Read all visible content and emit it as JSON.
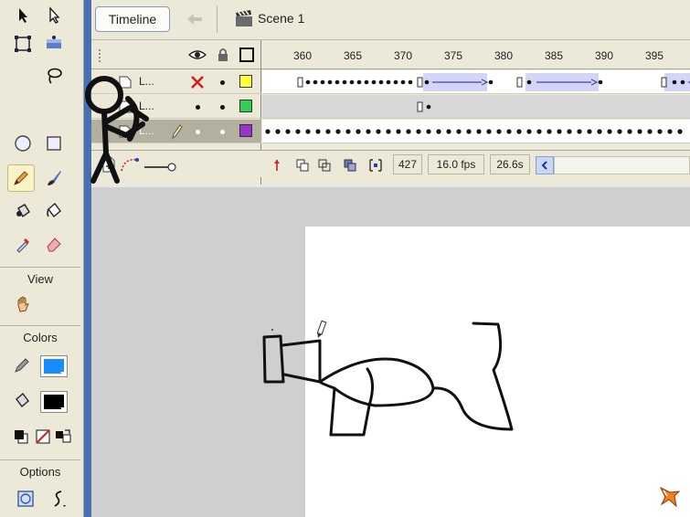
{
  "topbar": {
    "timeline_label": "Timeline",
    "scene_label": "Scene 1"
  },
  "tools": {
    "view_label": "View",
    "colors_label": "Colors",
    "options_label": "Options",
    "stroke_color": "#1a8cff",
    "fill_color": "#000000"
  },
  "timeline": {
    "ruler": [
      "360",
      "365",
      "370",
      "375",
      "380",
      "385",
      "390",
      "395"
    ],
    "layers": [
      {
        "name": "L..."
      },
      {
        "name": "L..."
      },
      {
        "name": "L..."
      }
    ],
    "layer_colors": [
      "#ffff33",
      "#33cc55",
      "#9933cc"
    ],
    "current_frame": "427",
    "fps": "16.0 fps",
    "elapsed": "26.6s"
  }
}
